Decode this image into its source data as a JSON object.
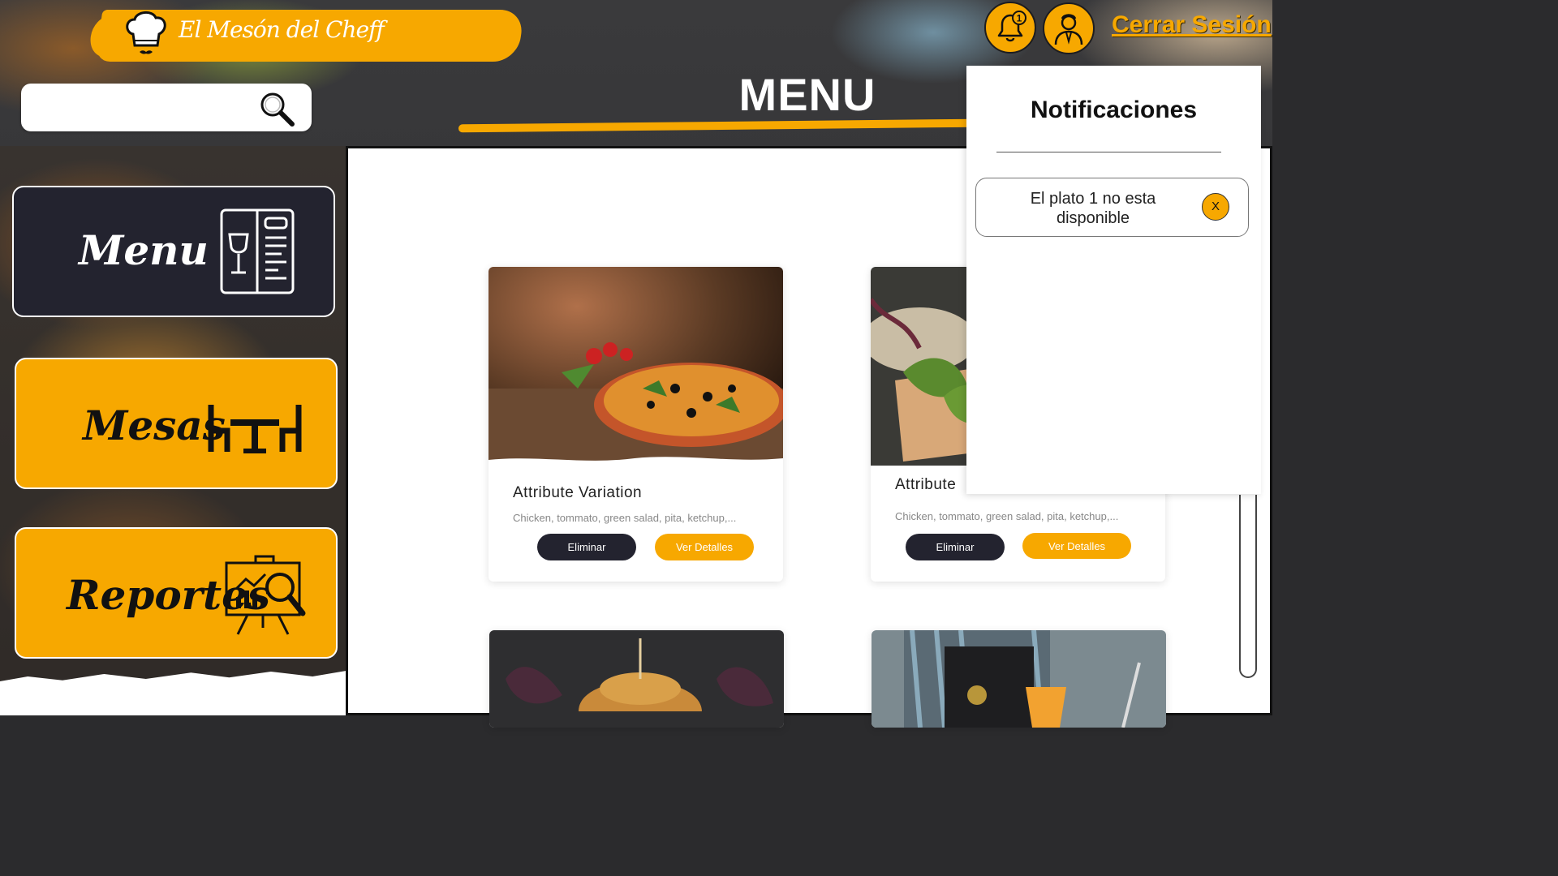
{
  "app": {
    "logo_text": "El Mesón del Cheff",
    "page_title": "MENU",
    "notification_count": "1",
    "logout_label": "Cerrar Sesión"
  },
  "search": {
    "placeholder": "",
    "value": ""
  },
  "sidebar": {
    "items": [
      {
        "label": "Menu",
        "icon": "menu-card-icon",
        "active": true
      },
      {
        "label": "Mesas",
        "icon": "tables-icon",
        "active": false
      },
      {
        "label": "Reportes",
        "icon": "report-chart-icon",
        "active": false
      }
    ]
  },
  "cards": [
    {
      "title": "Attribute Variation",
      "description": "Chicken, tommato, green salad, pita, ketchup,...",
      "image": "pizza",
      "delete_label": "Eliminar",
      "details_label": "Ver Detalles"
    },
    {
      "title": "Attribute",
      "description": "Chicken, tommato, green salad, pita, ketchup,...",
      "image": "sandwich",
      "delete_label": "Eliminar",
      "details_label": "Ver Detalles"
    },
    {
      "title": "",
      "description": "",
      "image": "burger",
      "delete_label": "",
      "details_label": ""
    },
    {
      "title": "",
      "description": "",
      "image": "chef-drink",
      "delete_label": "",
      "details_label": ""
    }
  ],
  "notifications": {
    "title": "Notificaciones",
    "items": [
      {
        "text": "El plato 1 no esta disponible",
        "close_label": "X"
      }
    ]
  },
  "colors": {
    "accent": "#f7a800",
    "dark": "#23232f",
    "panel": "#ffffff"
  }
}
